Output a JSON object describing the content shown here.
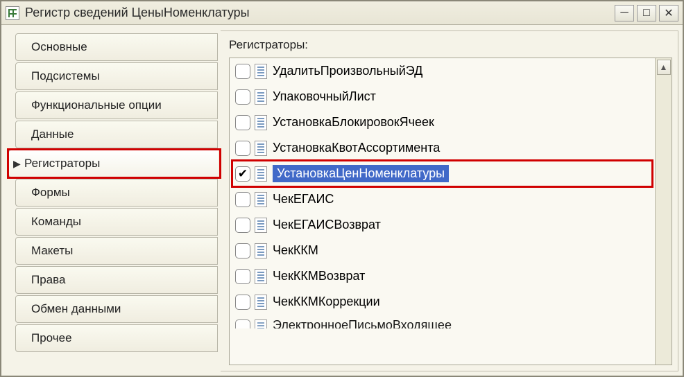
{
  "window": {
    "title": "Регистр сведений ЦеныНоменклатуры"
  },
  "sidebar": {
    "items": [
      {
        "label": "Основные",
        "active": false
      },
      {
        "label": "Подсистемы",
        "active": false
      },
      {
        "label": "Функциональные опции",
        "active": false
      },
      {
        "label": "Данные",
        "active": false
      },
      {
        "label": "Регистраторы",
        "active": true,
        "highlighted": true
      },
      {
        "label": "Формы",
        "active": false
      },
      {
        "label": "Команды",
        "active": false
      },
      {
        "label": "Макеты",
        "active": false
      },
      {
        "label": "Права",
        "active": false
      },
      {
        "label": "Обмен данными",
        "active": false
      },
      {
        "label": "Прочее",
        "active": false
      }
    ]
  },
  "main": {
    "section_label": "Регистраторы:",
    "items": [
      {
        "label": "УдалитьПроизвольныйЭД",
        "checked": false
      },
      {
        "label": "УпаковочныйЛист",
        "checked": false
      },
      {
        "label": "УстановкаБлокировокЯчеек",
        "checked": false
      },
      {
        "label": "УстановкаКвотАссортимента",
        "checked": false
      },
      {
        "label": "УстановкаЦенНоменклатуры",
        "checked": true,
        "selected": true,
        "highlighted": true
      },
      {
        "label": "ЧекЕГАИС",
        "checked": false
      },
      {
        "label": "ЧекЕГАИСВозврат",
        "checked": false
      },
      {
        "label": "ЧекККМ",
        "checked": false
      },
      {
        "label": "ЧекККМВозврат",
        "checked": false
      },
      {
        "label": "ЧекККМКоррекции",
        "checked": false
      },
      {
        "label": "ЭлектронноеПисьмоВходящее",
        "checked": false,
        "partial": true
      }
    ]
  }
}
